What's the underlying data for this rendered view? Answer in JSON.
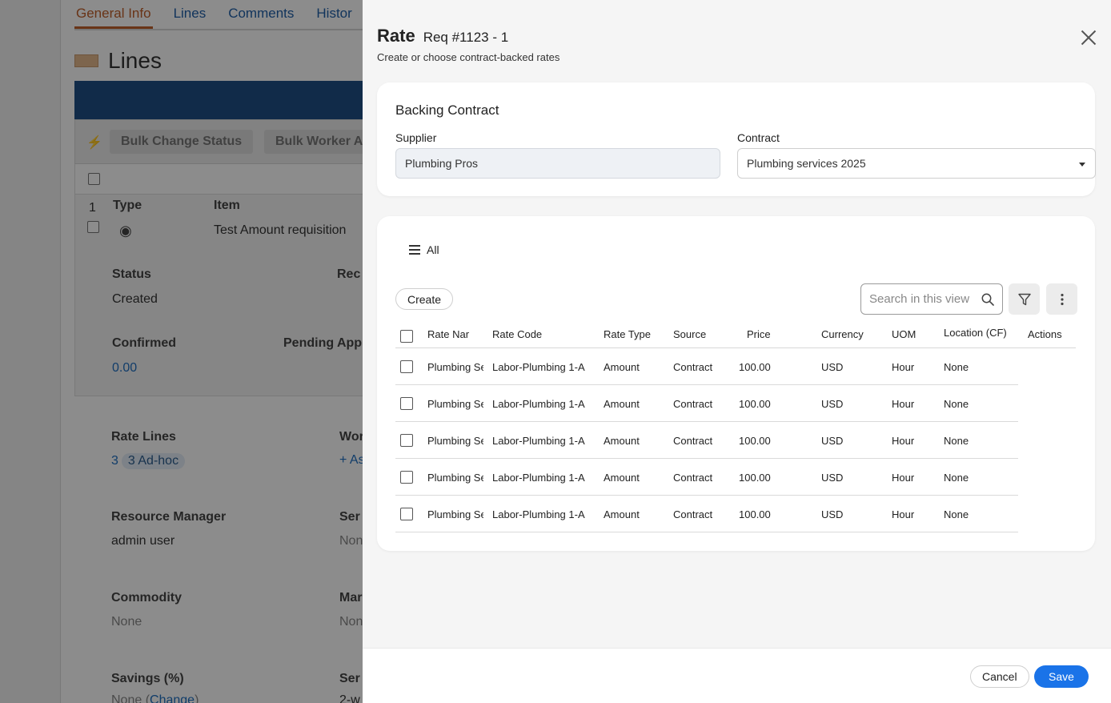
{
  "background": {
    "tabs": [
      "General Info",
      "Lines",
      "Comments",
      "Histor"
    ],
    "section_title": "Lines",
    "bulk_buttons": [
      "Bulk Change Status",
      "Bulk Worker A"
    ],
    "row_number": "1",
    "col_type": "Type",
    "col_item": "Item",
    "item_value": "Test Amount requisition",
    "status_label": "Status",
    "status_value": "Created",
    "rec_label": "Rec",
    "confirmed_label": "Confirmed",
    "confirmed_value": "0.00",
    "pending_label": "Pending App",
    "rate_lines_label": "Rate Lines",
    "rate_lines_count": "3",
    "rate_lines_chip": "3 Ad-hoc",
    "wor_label": "Wor",
    "wor_link": "+ As",
    "resource_manager_label": "Resource Manager",
    "resource_manager_value": "admin user",
    "ser_label": "Ser",
    "ser_value": "Non",
    "commodity_label": "Commodity",
    "commodity_value": "None",
    "mar_label": "Mar",
    "mar_value": "Non",
    "savings_label": "Savings (%)",
    "savings_value_prefix": "None (",
    "savings_change": "Change",
    "savings_value_suffix": ")",
    "ser2_label": "Ser",
    "ser2_value": "2-w"
  },
  "drawer": {
    "title": "Rate",
    "subtitle": "Req #1123 - 1",
    "description": "Create or choose contract-backed rates",
    "backing_contract": {
      "title": "Backing Contract",
      "supplier_label": "Supplier",
      "supplier_value": "Plumbing Pros",
      "contract_label": "Contract",
      "contract_value": "Plumbing services 2025"
    },
    "rates": {
      "view_label": "All",
      "create_label": "Create",
      "search_placeholder": "Search in this view",
      "columns": {
        "rate_name": "Rate Name",
        "rate_code": "Rate Code",
        "rate_type": "Rate Type",
        "source": "Source",
        "price": "Price",
        "currency": "Currency",
        "uom": "UOM",
        "location": "Location (CF)",
        "actions": "Actions"
      },
      "rows": [
        {
          "rate_name": "Plumbing Services",
          "rate_code": "Labor-Plumbing 1-A",
          "rate_type": "Amount",
          "source": "Contract",
          "price": "100.00",
          "currency": "USD",
          "uom": "Hour",
          "location": "None"
        },
        {
          "rate_name": "Plumbing Services",
          "rate_code": "Labor-Plumbing 1-A",
          "rate_type": "Amount",
          "source": "Contract",
          "price": "100.00",
          "currency": "USD",
          "uom": "Hour",
          "location": "None"
        },
        {
          "rate_name": "Plumbing Services",
          "rate_code": "Labor-Plumbing 1-A",
          "rate_type": "Amount",
          "source": "Contract",
          "price": "100.00",
          "currency": "USD",
          "uom": "Hour",
          "location": "None"
        },
        {
          "rate_name": "Plumbing Services",
          "rate_code": "Labor-Plumbing 1-A",
          "rate_type": "Amount",
          "source": "Contract",
          "price": "100.00",
          "currency": "USD",
          "uom": "Hour",
          "location": "None"
        },
        {
          "rate_name": "Plumbing Services",
          "rate_code": "Labor-Plumbing 1-A",
          "rate_type": "Amount",
          "source": "Contract",
          "price": "100.00",
          "currency": "USD",
          "uom": "Hour",
          "location": "None"
        }
      ]
    },
    "footer": {
      "cancel_label": "Cancel",
      "save_label": "Save"
    }
  },
  "colors": {
    "primary": "#1a73e8",
    "overlay": "rgba(0,0,0,0.45)",
    "tab_active": "#c0602a",
    "header_bar": "#1f4f86"
  }
}
